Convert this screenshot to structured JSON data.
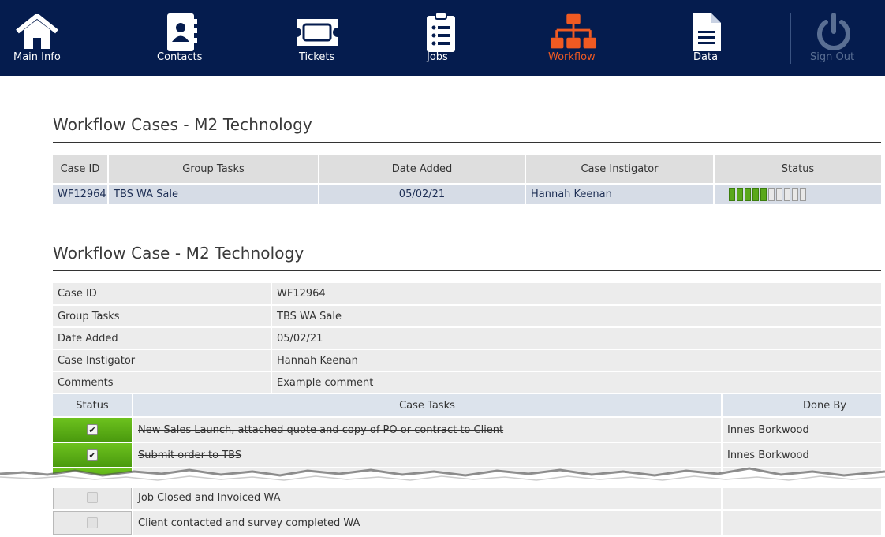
{
  "nav": {
    "items": [
      {
        "label": "Main Info",
        "icon": "home-icon"
      },
      {
        "label": "Contacts",
        "icon": "contacts-book-icon"
      },
      {
        "label": "Tickets",
        "icon": "ticket-icon"
      },
      {
        "label": "Jobs",
        "icon": "clipboard-list-icon"
      },
      {
        "label": "Workflow",
        "icon": "org-chart-icon"
      },
      {
        "label": "Data",
        "icon": "document-icon"
      },
      {
        "label": "Sign Out",
        "icon": "power-icon"
      }
    ],
    "active": "Workflow",
    "colors": {
      "bar": "#051c4e",
      "active": "#f05a22"
    }
  },
  "cases_section": {
    "title": "Workflow Cases - M2 Technology",
    "headers": [
      "Case ID",
      "Group Tasks",
      "Date Added",
      "Case Instigator",
      "Status"
    ],
    "rows": [
      {
        "case_id": "WF12964",
        "group_tasks": "TBS WA Sale",
        "date_added": "05/02/21",
        "instigator": "Hannah Keenan",
        "status_progress": 5,
        "status_total": 10
      }
    ]
  },
  "case_section": {
    "title": "Workflow Case - M2 Technology",
    "details": [
      {
        "label": "Case ID",
        "value": "WF12964"
      },
      {
        "label": "Group Tasks",
        "value": "TBS WA Sale"
      },
      {
        "label": "Date Added",
        "value": "05/02/21"
      },
      {
        "label": "Case Instigator",
        "value": "Hannah Keenan"
      },
      {
        "label": "Comments",
        "value": "Example comment"
      }
    ],
    "task_headers": [
      "Status",
      "Case Tasks",
      "Done By"
    ],
    "tasks": [
      {
        "done": true,
        "task": "New Sales Launch, attached quote and copy of PO or contract to Client",
        "done_by": "Innes Borkwood"
      },
      {
        "done": true,
        "task": "Submit order to TBS",
        "done_by": "Innes Borkwood"
      },
      {
        "done": false,
        "task": "Job Closed and Invoiced WA",
        "done_by": ""
      },
      {
        "done": false,
        "task": "Client contacted and survey completed WA",
        "done_by": ""
      }
    ]
  }
}
